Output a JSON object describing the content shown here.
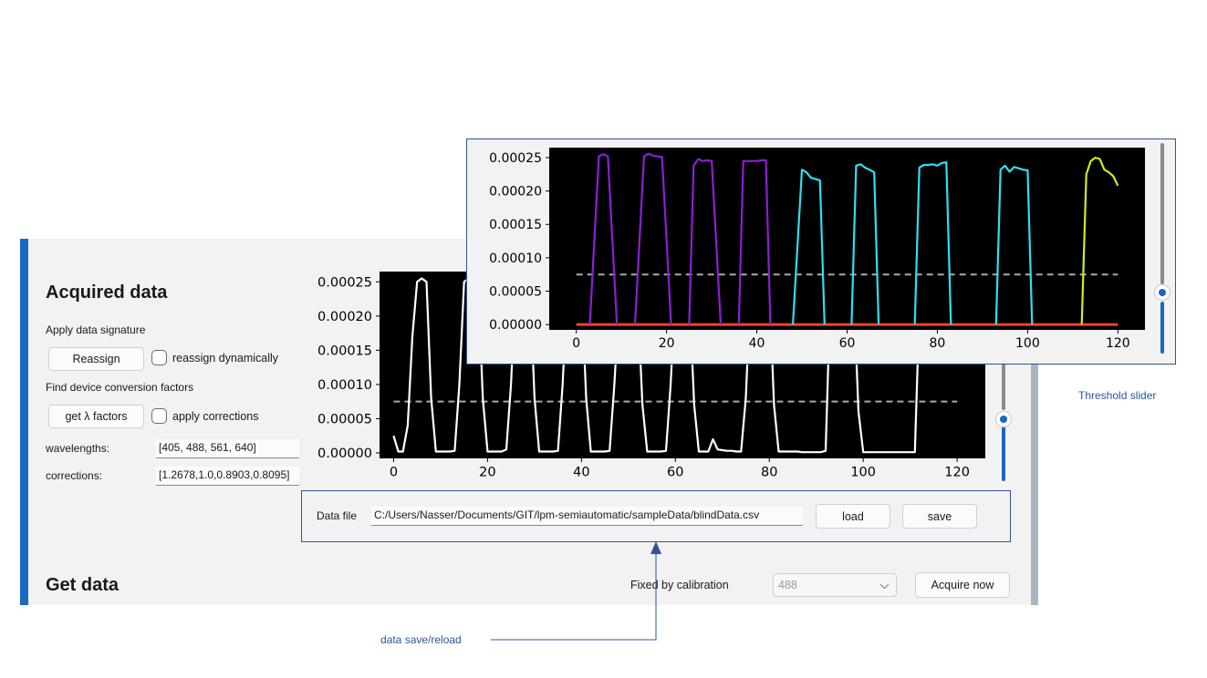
{
  "acquired": {
    "title": "Acquired data",
    "apply_signature_label": "Apply data signature",
    "reassign_button": "Reassign",
    "reassign_dynamic_label": "reassign dynamically",
    "find_factors_label": "Find device conversion factors",
    "get_factors_button": "get λ factors",
    "apply_corrections_label": "apply corrections",
    "wavelengths_label": "wavelengths:",
    "wavelengths_value": "[405, 488, 561, 640]",
    "corrections_label": "corrections:",
    "corrections_value": "[1.2678,1.0,0.8903,0.8095]"
  },
  "datafile": {
    "label": "Data file",
    "path": "C:/Users/Nasser/Documents/GIT/lpm-semiautomatic/sampleData/blindData.csv",
    "load_button": "load",
    "save_button": "save"
  },
  "get_data": {
    "title": "Get data",
    "fixed_label": "Fixed by calibration",
    "select_value": "488",
    "acquire_button": "Acquire now"
  },
  "annotations": {
    "save_reload": "data save/reload",
    "threshold": "Threshold slider"
  },
  "colors": {
    "accent": "#1a67c4",
    "annotation": "#2f5597",
    "violet": "#8b1fd6",
    "cyan": "#2de0f0",
    "lime": "#c7f02a",
    "red": "#f0451e"
  },
  "icons": {
    "dropdown": "chevron-down-icon",
    "annotation_arrow": "arrow-up-icon"
  },
  "chart_data": [
    {
      "type": "line",
      "title": "",
      "xlabel": "",
      "ylabel": "",
      "xlim": [
        -3,
        126
      ],
      "ylim": [
        -8e-06,
        0.000265
      ],
      "xticks": [
        0,
        20,
        40,
        60,
        80,
        100,
        120
      ],
      "yticks": [
        "0.00000",
        "0.00005",
        "0.00010",
        "0.00015",
        "0.00020",
        "0.00025"
      ],
      "background": "#000000",
      "threshold": 7.5e-05,
      "series": [
        {
          "color": "#ffffff",
          "x": [
            0,
            1,
            2,
            3,
            4,
            5,
            6,
            7,
            8,
            9,
            10,
            11,
            12,
            13,
            14,
            15,
            16,
            17,
            18,
            19,
            20,
            21,
            22,
            23,
            24,
            25,
            26,
            27,
            28,
            29,
            30,
            31,
            32,
            33,
            34,
            35,
            36,
            37,
            38,
            39,
            40,
            41,
            42,
            43,
            44,
            45,
            46,
            47,
            48,
            49,
            50,
            51,
            52,
            53,
            54,
            55,
            56,
            57,
            58,
            59,
            60,
            61,
            62,
            63,
            64,
            65,
            66,
            67,
            68,
            69,
            70,
            71,
            72,
            73,
            74,
            75,
            76,
            77,
            78,
            79,
            80,
            81,
            82,
            83,
            84,
            85,
            86,
            87,
            88,
            89,
            90,
            91,
            92,
            93,
            94,
            95,
            96,
            97,
            98,
            99,
            100,
            101,
            102,
            103,
            104,
            105,
            106,
            107,
            108,
            109,
            110,
            111,
            112,
            113,
            114,
            115,
            116,
            117,
            118,
            119,
            120
          ],
          "y": [
            2.5e-05,
            2e-06,
            2e-06,
            4e-05,
            0.00017,
            0.00025,
            0.000255,
            0.00025,
            8e-05,
            2e-06,
            2e-06,
            2e-06,
            2e-06,
            3e-06,
            0.0001,
            0.00025,
            0.000255,
            0.000253,
            0.00025,
            8e-05,
            2e-06,
            2e-06,
            2e-06,
            2e-06,
            5e-06,
            0.0001,
            0.00025,
            0.00025,
            0.000245,
            0.00025,
            8e-05,
            2e-06,
            2e-06,
            2e-06,
            2e-06,
            3e-06,
            0.0001,
            0.000245,
            0.000245,
            0.000245,
            0.000245,
            8e-05,
            2e-06,
            2e-06,
            2e-06,
            2e-06,
            3e-06,
            0.0001,
            0.00022,
            0.000235,
            0.00023,
            0.000222,
            0.00022,
            7e-05,
            2e-06,
            2e-06,
            2e-06,
            2e-06,
            3e-06,
            0.0001,
            0.00024,
            0.000238,
            0.000232,
            0.000228,
            7e-05,
            2e-06,
            2e-06,
            2e-06,
            2e-05,
            5e-06,
            4e-06,
            3e-06,
            3e-06,
            2e-06,
            2e-06,
            8e-05,
            0.00024,
            0.000241,
            0.000242,
            0.000241,
            0.000245,
            7e-05,
            2e-06,
            2e-06,
            2e-06,
            2e-06,
            2e-06,
            1e-06,
            1e-06,
            1e-06,
            1e-06,
            1e-06,
            3e-06,
            0.00023,
            0.000238,
            0.000232,
            0.000235,
            0.000233,
            0.00023,
            6e-05,
            1e-06,
            1e-06,
            1e-06,
            1e-06,
            1e-06,
            1e-06,
            1e-06,
            1e-06,
            1e-06,
            1e-06,
            1e-06,
            1e-06,
            0.00022,
            0.000245,
            0.00025,
            0.000235,
            0.000231,
            0.000226,
            0.000215,
            0.000205,
            0.000205
          ]
        }
      ]
    },
    {
      "type": "line",
      "title": "",
      "xlabel": "",
      "ylabel": "",
      "xlim": [
        -6,
        126
      ],
      "ylim": [
        -8e-06,
        0.000265
      ],
      "xticks": [
        0,
        20,
        40,
        60,
        80,
        100,
        120
      ],
      "yticks": [
        "0.00000",
        "0.00005",
        "0.00010",
        "0.00015",
        "0.00020",
        "0.00025"
      ],
      "background": "#000000",
      "threshold": 7.5e-05,
      "baseline": 0,
      "series": [
        {
          "color": "#8b1fd6",
          "x": [
            3,
            5,
            6,
            7,
            9
          ],
          "y": [
            0,
            0.000252,
            0.000255,
            0.000252,
            0
          ]
        },
        {
          "color": "#8b1fd6",
          "x": [
            13,
            15,
            16,
            17,
            19,
            21
          ],
          "y": [
            0,
            0.000252,
            0.000256,
            0.000253,
            0.000251,
            0
          ]
        },
        {
          "color": "#8b1fd6",
          "x": [
            25,
            26,
            27,
            28,
            29,
            30,
            32
          ],
          "y": [
            0,
            0.000238,
            0.000248,
            0.000245,
            0.000246,
            0.000245,
            0
          ]
        },
        {
          "color": "#8b1fd6",
          "x": [
            36,
            37,
            38,
            39,
            40,
            41,
            42,
            43
          ],
          "y": [
            0,
            0.000245,
            0.000245,
            0.000245,
            0.000245,
            0.000246,
            0.000246,
            0
          ]
        },
        {
          "color": "#2de0f0",
          "x": [
            48,
            50,
            51,
            52,
            53,
            54,
            55
          ],
          "y": [
            0,
            0.000232,
            0.000228,
            0.00022,
            0.000218,
            0.000216,
            0
          ]
        },
        {
          "color": "#2de0f0",
          "x": [
            61,
            62,
            63,
            64,
            65,
            66,
            67
          ],
          "y": [
            0,
            0.000238,
            0.00024,
            0.000235,
            0.000232,
            0.000228,
            0
          ]
        },
        {
          "color": "#2de0f0",
          "x": [
            75,
            76,
            77,
            78,
            79,
            80,
            81,
            82,
            83
          ],
          "y": [
            0,
            0.000235,
            0.000239,
            0.000239,
            0.00024,
            0.000238,
            0.000242,
            0.000243,
            0
          ]
        },
        {
          "color": "#2de0f0",
          "x": [
            93,
            94,
            95,
            96,
            97,
            98,
            99,
            100,
            101
          ],
          "y": [
            0,
            0.000232,
            0.000238,
            0.000229,
            0.000236,
            0.000234,
            0.000232,
            0.000231,
            0
          ]
        },
        {
          "color": "#c7f02a",
          "x": [
            112,
            113,
            114,
            115,
            116,
            117,
            118,
            119,
            120
          ],
          "y": [
            0,
            0.000225,
            0.000245,
            0.00025,
            0.000248,
            0.000232,
            0.000228,
            0.000222,
            0.000208
          ]
        }
      ]
    }
  ]
}
